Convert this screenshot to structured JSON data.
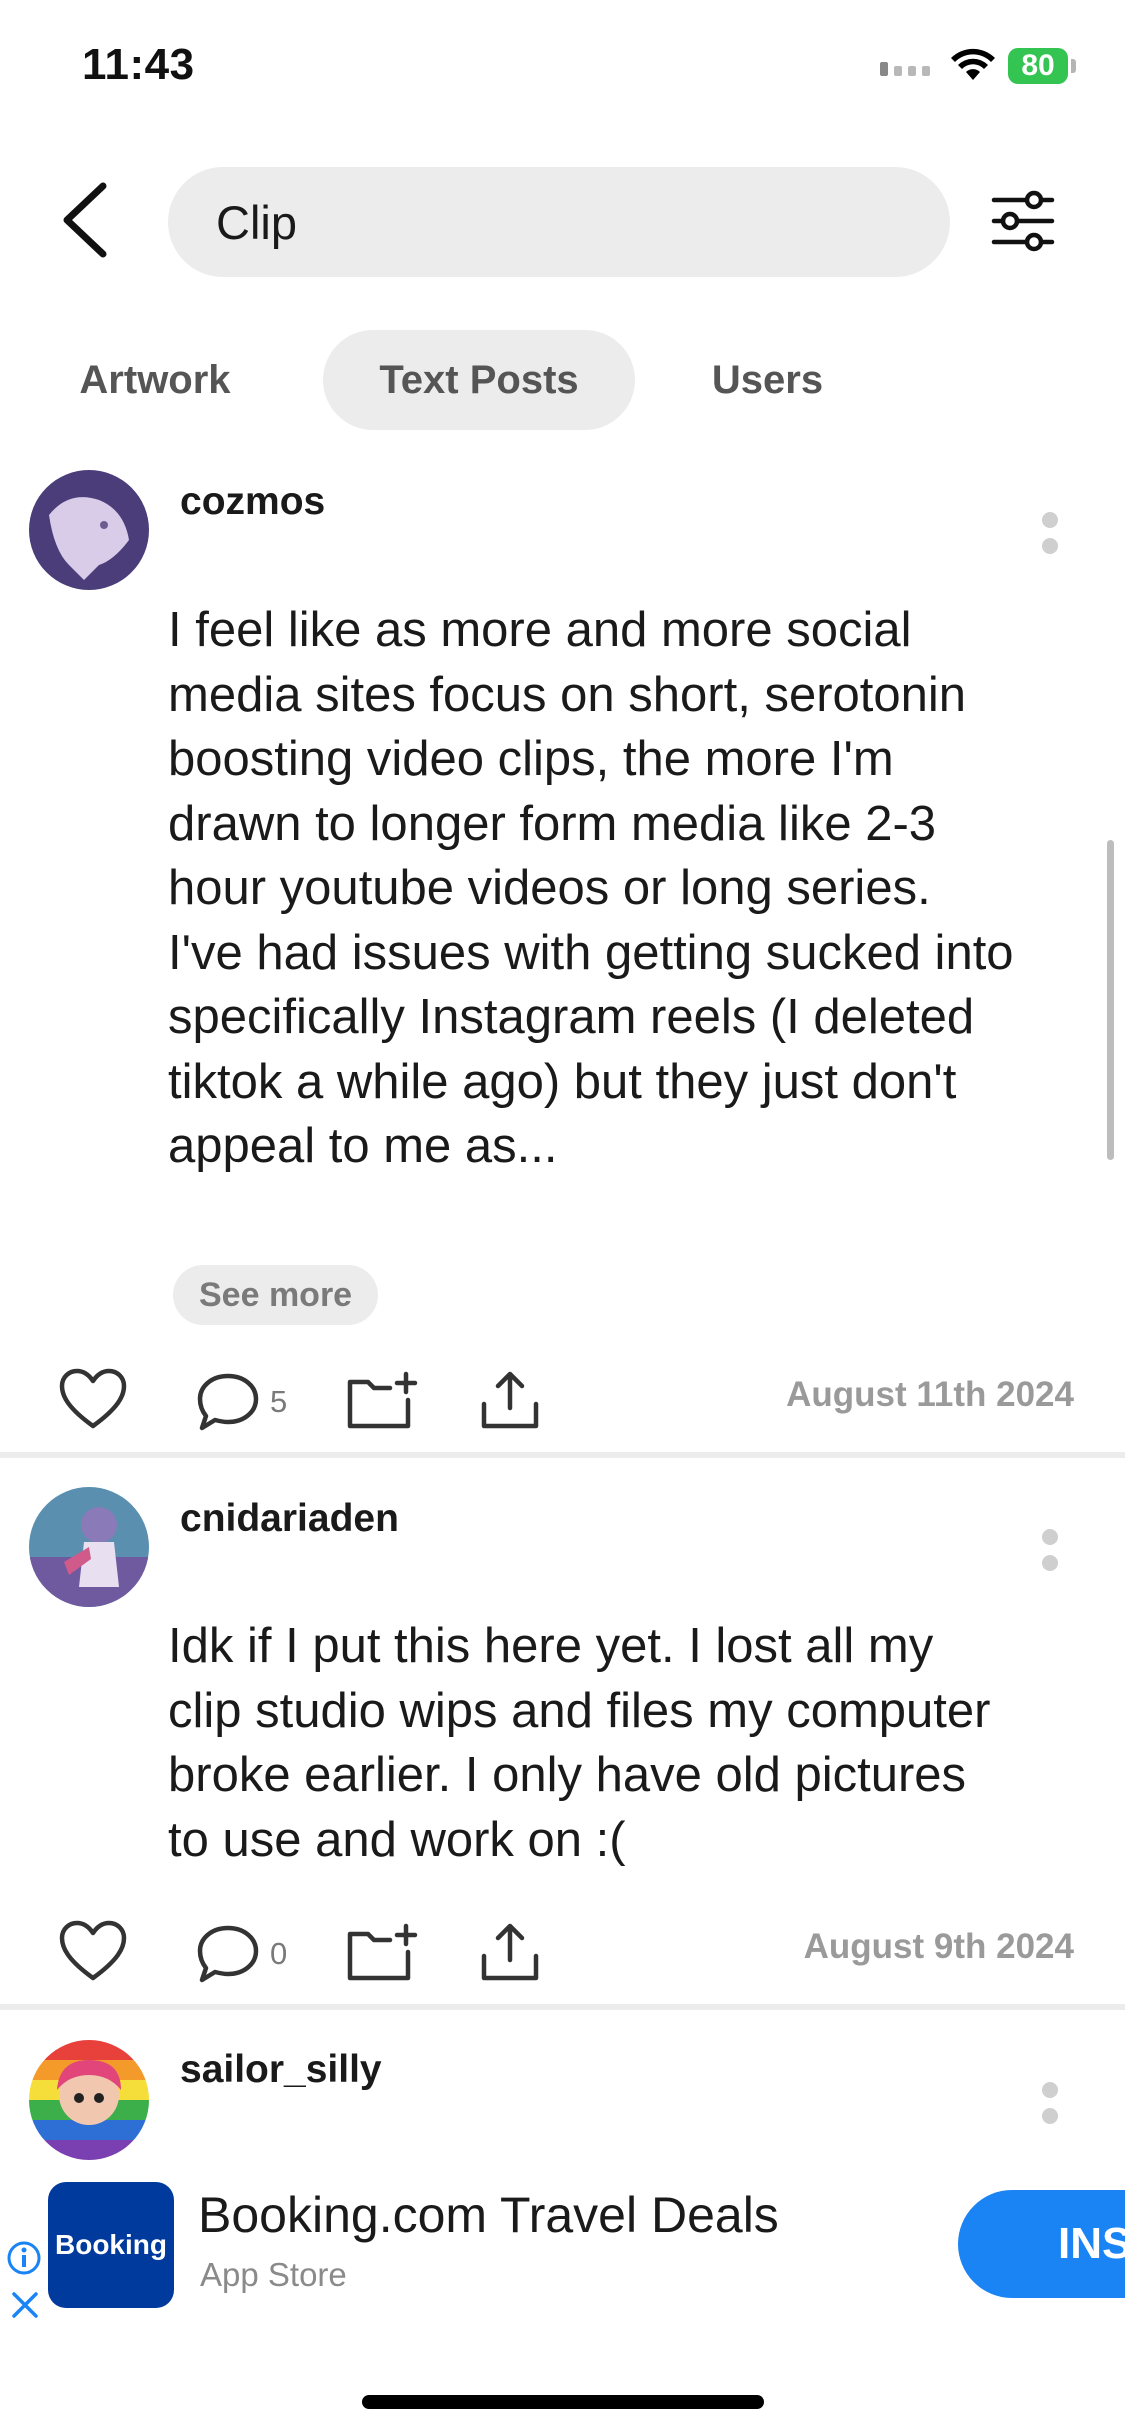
{
  "status_bar": {
    "time": "11:43",
    "battery": "80"
  },
  "search": {
    "query": "Clip"
  },
  "tabs": [
    {
      "label": "Artwork",
      "active": false
    },
    {
      "label": "Text Posts",
      "active": true
    },
    {
      "label": "Users",
      "active": false
    }
  ],
  "posts": [
    {
      "username": "cozmos",
      "text": "I feel like as more and more social media sites focus on short, serotonin boosting video clips, the more I'm drawn to longer form media like 2-3 hour youtube videos or long series. I've had issues with getting sucked into specifically Instagram reels (I deleted tiktok a while ago) but they just don't appeal to me as...",
      "see_more": "See more",
      "comments": "5",
      "date": "August 11th 2024"
    },
    {
      "username": "cnidariaden",
      "text": "Idk if I put this here yet. I lost all my clip studio wips and files my computer broke earlier. I only have old pictures to use and work on :(",
      "comments": "0",
      "date": "August 9th 2024"
    },
    {
      "username": "sailor_silly"
    }
  ],
  "ad": {
    "logo_text": "Booking",
    "title": "Booking.com Travel Deals",
    "subtitle": "App Store",
    "cta": "INS"
  },
  "colors": {
    "accent": "#1a84f5",
    "battery": "#33c452",
    "ad_logo": "#003a9c"
  }
}
